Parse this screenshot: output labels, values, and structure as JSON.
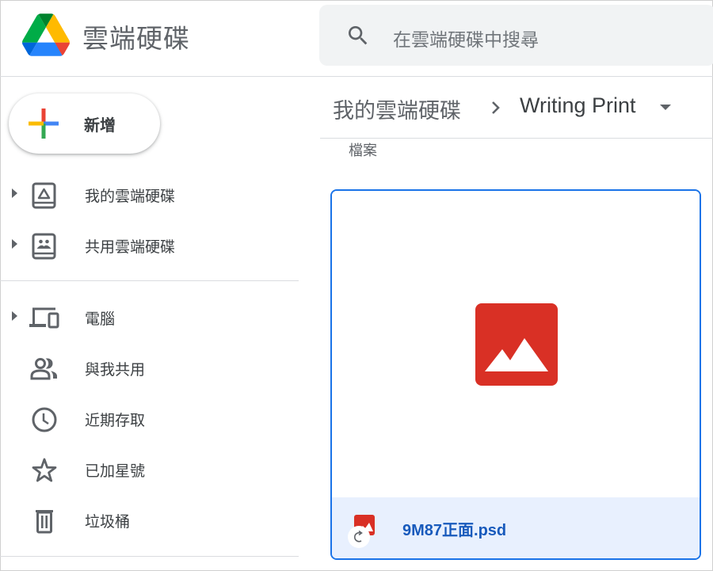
{
  "header": {
    "app_title": "雲端硬碟",
    "search": {
      "placeholder": "在雲端硬碟中搜尋"
    }
  },
  "sidebar": {
    "new_button_label": "新增",
    "items": [
      {
        "label": "我的雲端硬碟",
        "icon": "my-drive-icon",
        "expandable": true
      },
      {
        "label": "共用雲端硬碟",
        "icon": "shared-drives-icon",
        "expandable": true
      },
      {
        "label": "電腦",
        "icon": "computers-icon",
        "expandable": true
      },
      {
        "label": "與我共用",
        "icon": "shared-with-me-icon",
        "expandable": false
      },
      {
        "label": "近期存取",
        "icon": "clock-icon",
        "expandable": false
      },
      {
        "label": "已加星號",
        "icon": "star-icon",
        "expandable": false
      },
      {
        "label": "垃圾桶",
        "icon": "trash-icon",
        "expandable": false
      }
    ]
  },
  "main": {
    "breadcrumb": {
      "root": "我的雲端硬碟",
      "separator_icon": "chevron-right-icon",
      "current": "Writing Print"
    },
    "section_label": "檔案",
    "files": [
      {
        "name": "9M87正面.psd",
        "type_icon": "image-file-icon",
        "is_shortcut": true,
        "selected": true
      }
    ]
  },
  "colors": {
    "accent_blue": "#1a73e8",
    "selected_bg": "#e8f0fe",
    "file_name_blue": "#185abc",
    "image_red": "#d93025",
    "icon_gray": "#5f6368"
  }
}
